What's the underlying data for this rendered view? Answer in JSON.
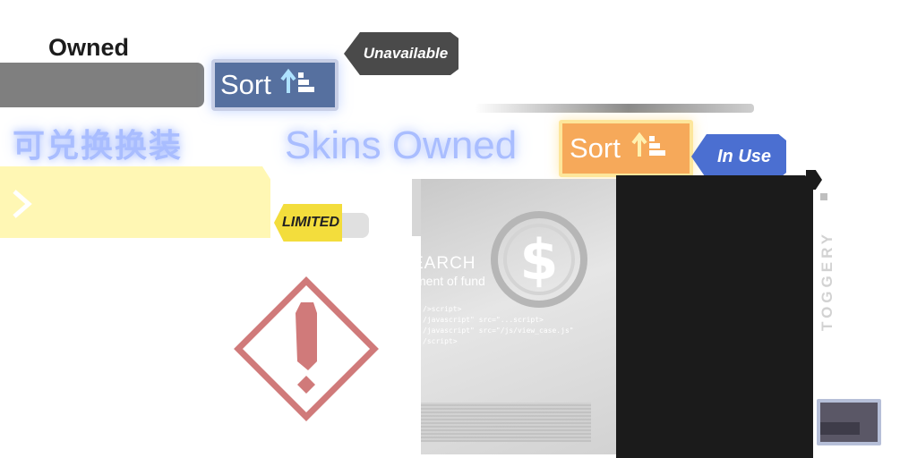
{
  "owned_tab": {
    "label": "Owned"
  },
  "sort_primary": {
    "label": "Sort",
    "icon": "sort-ascending-icon"
  },
  "sort_secondary": {
    "label": "Sort",
    "icon": "sort-ascending-icon"
  },
  "badges": {
    "unavailable": "Unavailable",
    "in_use": "In Use",
    "limited": "LIMITED"
  },
  "titles": {
    "cn_redeemable": "可兑换换装",
    "skins_owned": "Skins Owned"
  },
  "card": {
    "search_text": "EARCH",
    "sub_text": "ment of fund",
    "code_text": "/>script>\n/javascript\" src=\"...script>\n/javascript\" src=\"/js/view_case.js\"\n/script>",
    "emblem_icon": "dollar-coin-icon"
  },
  "side_label": "TOGGERY",
  "colors": {
    "sort_blue": "#56709f",
    "sort_orange": "#f6a95a",
    "in_use_blue": "#4b6fd1",
    "unavailable_gray": "#4a4a4a",
    "limited_yellow": "#f3dd3c",
    "warning_red": "#d07a7a"
  },
  "icons": {
    "warning": "warning-diamond-icon",
    "chevron": "chevron-right-icon"
  }
}
